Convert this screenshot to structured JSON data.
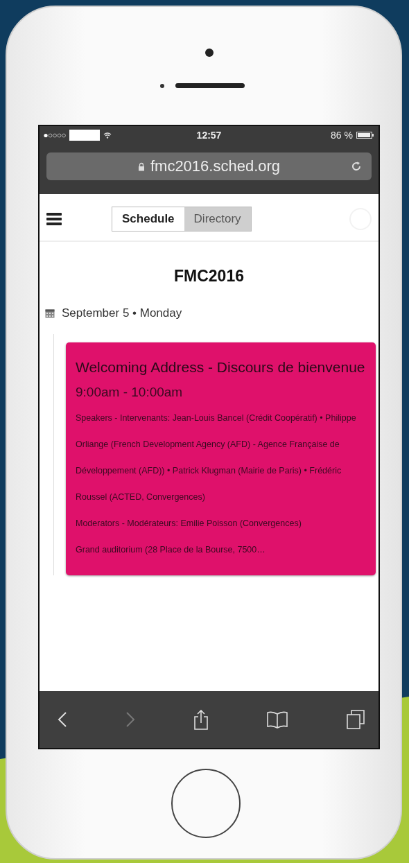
{
  "status_bar": {
    "time": "12:57",
    "battery_text": "86 %"
  },
  "address_bar": {
    "url": "fmc2016.sched.org"
  },
  "nav": {
    "tabs": [
      {
        "label": "Schedule",
        "selected": true
      },
      {
        "label": "Directory",
        "selected": false
      }
    ]
  },
  "page": {
    "title": "FMC2016",
    "date": "September 5 • Monday"
  },
  "event": {
    "title": "Welcoming Address - Discours de bienvenue",
    "time": "9:00am - 10:00am",
    "details": [
      "Speakers - Intervenants: Jean-Louis Bancel (Crédit Coopératif) • Philippe Orliange (French Development Agency (AFD) - Agence Française de Développement (AFD)) • Patrick Klugman (Mairie de Paris) • Frédéric Roussel (ACTED, Convergences)",
      "Moderators - Modérateurs: Emilie Poisson (Convergences)",
      "Grand auditorium (28 Place de la Bourse, 7500…"
    ]
  }
}
